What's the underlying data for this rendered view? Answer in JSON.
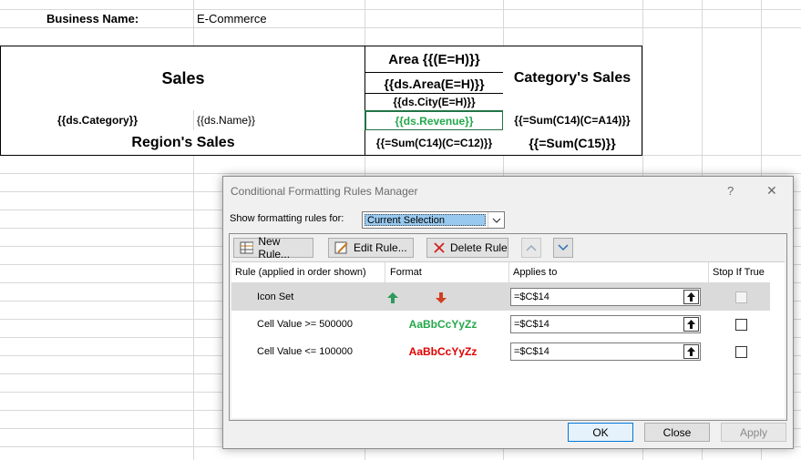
{
  "sheet": {
    "business_name_label": "Business Name:",
    "business_name_value": "E-Commerce",
    "sales": "Sales",
    "area": "Area {{(E=H)}}",
    "ds_area": "{{ds.Area(E=H)}}",
    "ds_city": "{{ds.City(E=H)}}",
    "category_sales": "Category's Sales",
    "ds_category": "{{ds.Category}}",
    "ds_name": "{{ds.Name}}",
    "ds_revenue": "{{ds.Revenue}}",
    "sum_c14_a14": "{{=Sum(C14)(C=A14)}}",
    "regions_sales": "Region's Sales",
    "sum_c14_c12": "{{=Sum(C14)(C=C12)}}",
    "sum_c15": "{{=Sum(C15)}}"
  },
  "dialog": {
    "title": "Conditional Formatting Rules Manager",
    "help": "?",
    "close": "✕",
    "show_rules_label": "Show formatting rules for:",
    "show_rules_value": "Current Selection",
    "toolbar": {
      "new_rule": "New Rule...",
      "edit_rule": "Edit Rule...",
      "delete_rule": "Delete Rule",
      "up_arrow": "⌃",
      "down_arrow": "⌄"
    },
    "columns": {
      "rule": "Rule (applied in order shown)",
      "format": "Format",
      "applies_to": "Applies to",
      "stop_if_true": "Stop If True"
    },
    "rules": [
      {
        "label": "Icon Set",
        "format": "",
        "applies_to": "=$C$14"
      },
      {
        "label": "Cell Value >= 500000",
        "format": "AaBbCcYyZz",
        "applies_to": "=$C$14"
      },
      {
        "label": "Cell Value <= 100000",
        "format": "AaBbCcYyZz",
        "applies_to": "=$C$14"
      }
    ],
    "buttons": {
      "ok": "OK",
      "close": "Close",
      "apply": "Apply"
    },
    "colors": {
      "green_format": "#22a84a",
      "red_format": "#e00000",
      "selection_blue": "#99c9ef"
    }
  }
}
